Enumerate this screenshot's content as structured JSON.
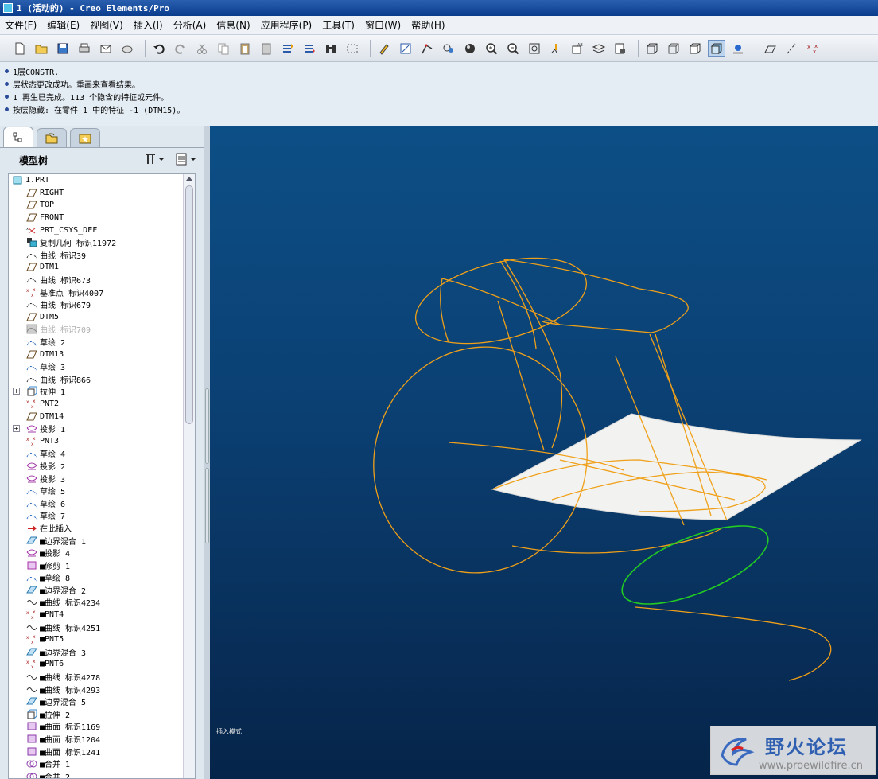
{
  "window": {
    "title": "1 (活动的) - Creo Elements/Pro"
  },
  "menu": [
    "文件(F)",
    "编辑(E)",
    "视图(V)",
    "插入(I)",
    "分析(A)",
    "信息(N)",
    "应用程序(P)",
    "工具(T)",
    "窗口(W)",
    "帮助(H)"
  ],
  "messages": [
    "1层CONSTR.",
    "层状态更改成功。重画来查看结果。",
    "1 再生已完成。113 个隐含的特征或元件。",
    "按层隐藏: 在零件 1 中的特征 -1 (DTM15)。"
  ],
  "panel": {
    "title": "模型树"
  },
  "tree": [
    {
      "label": "1.PRT",
      "icon": "part-icon"
    },
    {
      "label": "RIGHT",
      "icon": "datum-plane-icon"
    },
    {
      "label": "TOP",
      "icon": "datum-plane-icon"
    },
    {
      "label": "FRONT",
      "icon": "datum-plane-icon"
    },
    {
      "label": "PRT_CSYS_DEF",
      "icon": "csys-icon"
    },
    {
      "label": "复制几何 标识11972",
      "icon": "copy-geom-icon"
    },
    {
      "label": "曲线 标识39",
      "icon": "curve-icon"
    },
    {
      "label": "DTM1",
      "icon": "datum-plane-icon"
    },
    {
      "label": "曲线 标识673",
      "icon": "curve-icon"
    },
    {
      "label": "基准点 标识4007",
      "icon": "datum-point-icon"
    },
    {
      "label": "曲线 标识679",
      "icon": "curve-icon"
    },
    {
      "label": "DTM5",
      "icon": "datum-plane-icon"
    },
    {
      "label": "曲线 标识709",
      "icon": "curve-hidden-icon",
      "dim": true
    },
    {
      "label": "草绘 2",
      "icon": "sketch-icon"
    },
    {
      "label": "DTM13",
      "icon": "datum-plane-icon"
    },
    {
      "label": "草绘 3",
      "icon": "sketch-icon"
    },
    {
      "label": "曲线 标识866",
      "icon": "curve-icon"
    },
    {
      "label": "拉伸 1",
      "icon": "extrude-icon",
      "expander": "+"
    },
    {
      "label": "PNT2",
      "icon": "datum-point-icon"
    },
    {
      "label": "DTM14",
      "icon": "datum-plane-icon"
    },
    {
      "label": "投影 1",
      "icon": "project-icon",
      "expander": "+"
    },
    {
      "label": "PNT3",
      "icon": "datum-point-icon"
    },
    {
      "label": "草绘 4",
      "icon": "sketch-icon"
    },
    {
      "label": "投影 2",
      "icon": "project-icon"
    },
    {
      "label": "投影 3",
      "icon": "project-icon"
    },
    {
      "label": "草绘 5",
      "icon": "sketch-icon"
    },
    {
      "label": "草绘 6",
      "icon": "sketch-icon"
    },
    {
      "label": "草绘 7",
      "icon": "sketch-icon"
    },
    {
      "label": "在此插入",
      "icon": "insert-here-icon"
    },
    {
      "label": "■边界混合 1",
      "icon": "boundary-blend-icon"
    },
    {
      "label": "■投影 4",
      "icon": "project-icon"
    },
    {
      "label": "■修剪 1",
      "icon": "trim-icon"
    },
    {
      "label": "■草绘 8",
      "icon": "sketch-icon"
    },
    {
      "label": "■边界混合 2",
      "icon": "boundary-blend-icon"
    },
    {
      "label": "■曲线 标识4234",
      "icon": "curve-wave-icon"
    },
    {
      "label": "■PNT4",
      "icon": "datum-point-icon"
    },
    {
      "label": "■曲线 标识4251",
      "icon": "curve-wave-icon"
    },
    {
      "label": "■PNT5",
      "icon": "datum-point-icon"
    },
    {
      "label": "■边界混合 3",
      "icon": "boundary-blend-icon"
    },
    {
      "label": "■PNT6",
      "icon": "datum-point-icon"
    },
    {
      "label": "■曲线 标识4278",
      "icon": "curve-wave-icon"
    },
    {
      "label": "■曲线 标识4293",
      "icon": "curve-wave-icon"
    },
    {
      "label": "■边界混合 5",
      "icon": "boundary-blend-icon"
    },
    {
      "label": "■拉伸 2",
      "icon": "extrude-icon"
    },
    {
      "label": "■曲面 标识1169",
      "icon": "surface-icon"
    },
    {
      "label": "■曲面 标识1204",
      "icon": "surface-icon"
    },
    {
      "label": "■曲面 标识1241",
      "icon": "surface-icon"
    },
    {
      "label": "■合并 1",
      "icon": "merge-icon"
    },
    {
      "label": "■合并 2",
      "icon": "merge-icon"
    }
  ],
  "viewport": {
    "status": "插入模式"
  },
  "watermark": {
    "name": "野火论坛",
    "url": "www.proewildfire.cn"
  },
  "colors": {
    "curve": "#f0a018",
    "green_curve": "#22cc22",
    "surface": "#f4f4f4",
    "viewport_top": "#0c4f86",
    "viewport_bottom": "#062449"
  }
}
